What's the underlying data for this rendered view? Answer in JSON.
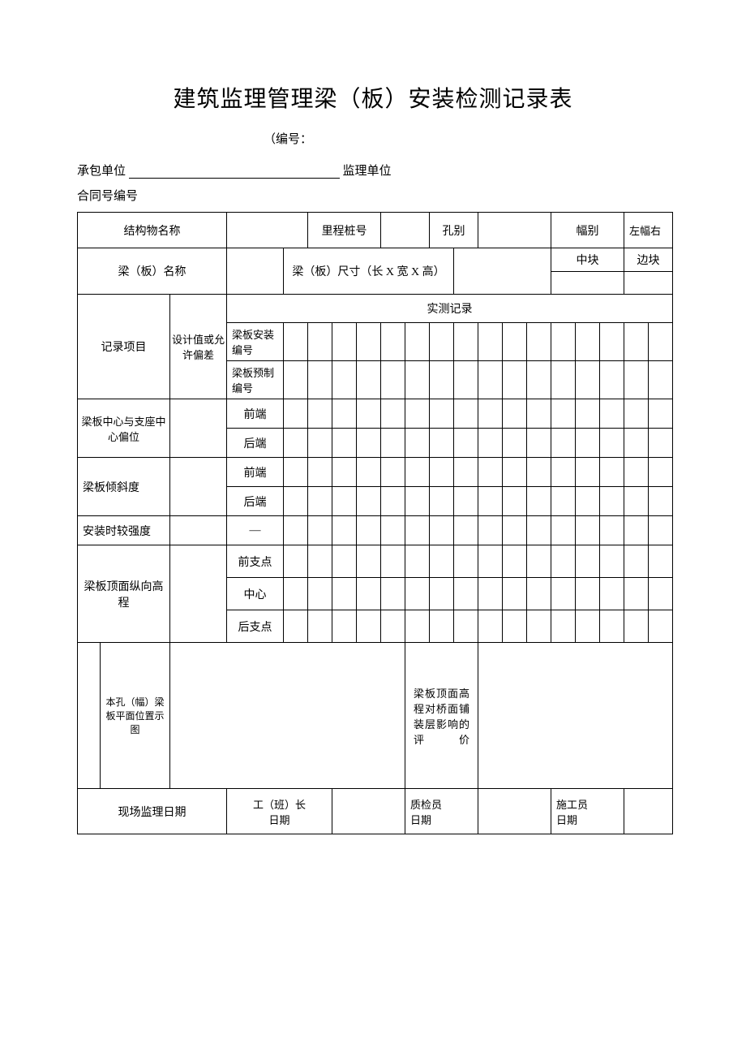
{
  "title": "建筑监理管理梁（板）安装检测记录表",
  "serial_label": "（编号：",
  "contractor_label": "承包单位",
  "supervisor_label": "监理单位",
  "contract_no_label": "合同号编号",
  "row1": {
    "struct_name": "结构物名称",
    "mileage": "里程桩号",
    "hole": "孔别",
    "width": "幅别",
    "lr": "左幅右"
  },
  "row2": {
    "beam_name": "梁（板）名称",
    "size": "梁（板）尺寸（长 X 宽 X 高）",
    "mid": "中块",
    "side": "边块"
  },
  "records_header": "实测记录",
  "record_item": "记录项目",
  "design_tolerance": "设计值或允许偏差",
  "install_no": "梁板安装编号",
  "prefab_no": "梁板预制编号",
  "center_offset": "梁板中心与支座中心偏位",
  "front": "前端",
  "rear": "后端",
  "tilt": "梁板倾斜度",
  "strength": "安装时较强度",
  "dash": "—",
  "elevation": "梁板顶面纵向高程",
  "front_support": "前支点",
  "center": "中心",
  "rear_support": "后支点",
  "plan_diagram": "本孔（幅）梁板平面位置示图",
  "eval_text": "梁板顶面高程对桥面铺装层影响的评价",
  "sig": {
    "site_supervision": "现场监理日期",
    "foreman": "工（班）长",
    "date": "日期",
    "qc": "质检员",
    "constructor": "施工员"
  }
}
